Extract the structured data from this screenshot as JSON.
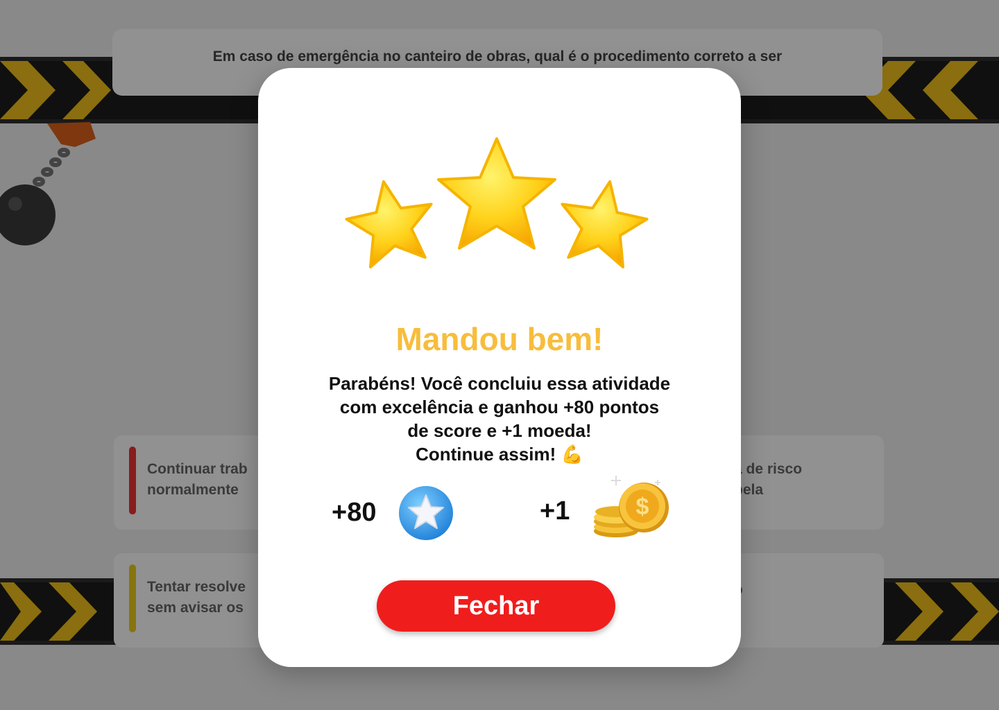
{
  "background": {
    "question_text": "Em caso de emergência no canteiro de obras, qual é o procedimento correto a ser",
    "options": [
      {
        "text": "Continuar trab\nnormalmente",
        "color": "#e33333"
      },
      {
        "text": "a de risco\npela",
        "color": "#ffffff"
      },
      {
        "text": "Tentar resolve\nsem avisar os",
        "color": "#f0cc1a"
      },
      {
        "text": "o",
        "color": "#ffffff"
      }
    ],
    "stripe_colors": {
      "dark": "#1d1d1d",
      "yellow": "#f2c21b"
    }
  },
  "modal": {
    "stars_icon": "three-gold-stars",
    "title": "Mandou bem!",
    "message": "Parabéns! Você concluiu essa atividade\ncom excelência e ganhou +80 pontos\nde score e +1 moeda!\nContinue assim! 💪",
    "rewards": {
      "score_value": "+80",
      "score_icon": "blue-star-badge-icon",
      "coin_value": "+1",
      "coin_icon": "gold-coins-icon"
    },
    "close_label": "Fechar"
  },
  "colors": {
    "title": "#f7bd3c",
    "button": "#f01d1d",
    "star": "#ffcc1a"
  }
}
